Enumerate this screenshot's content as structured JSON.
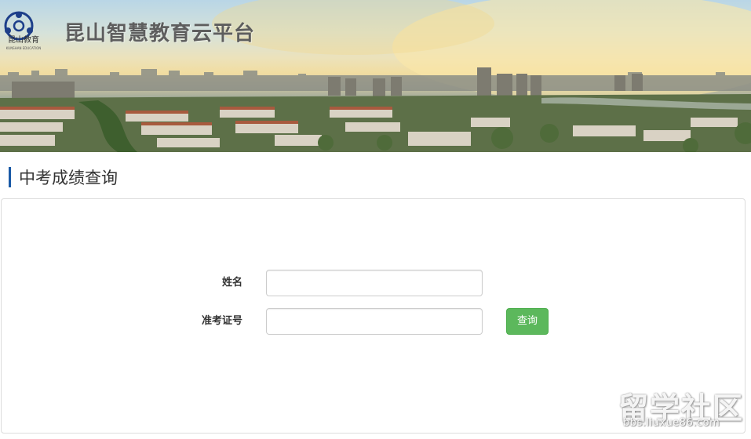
{
  "header": {
    "logo_icon": "kunshan-education-emblem",
    "logo_caption": "昆山教育",
    "logo_subtext": "KUNSHAN EDUCATION",
    "site_title": "昆山智慧教育云平台"
  },
  "section": {
    "title": "中考成绩查询",
    "accent_color": "#1a5aa6"
  },
  "form": {
    "name_label": "姓名",
    "name_value": "",
    "exam_id_label": "准考证号",
    "exam_id_value": "",
    "query_button": "查询",
    "button_color": "#5cb85c"
  },
  "watermark": {
    "main": "留学社区",
    "url": "bbs.liuxue86.com"
  }
}
